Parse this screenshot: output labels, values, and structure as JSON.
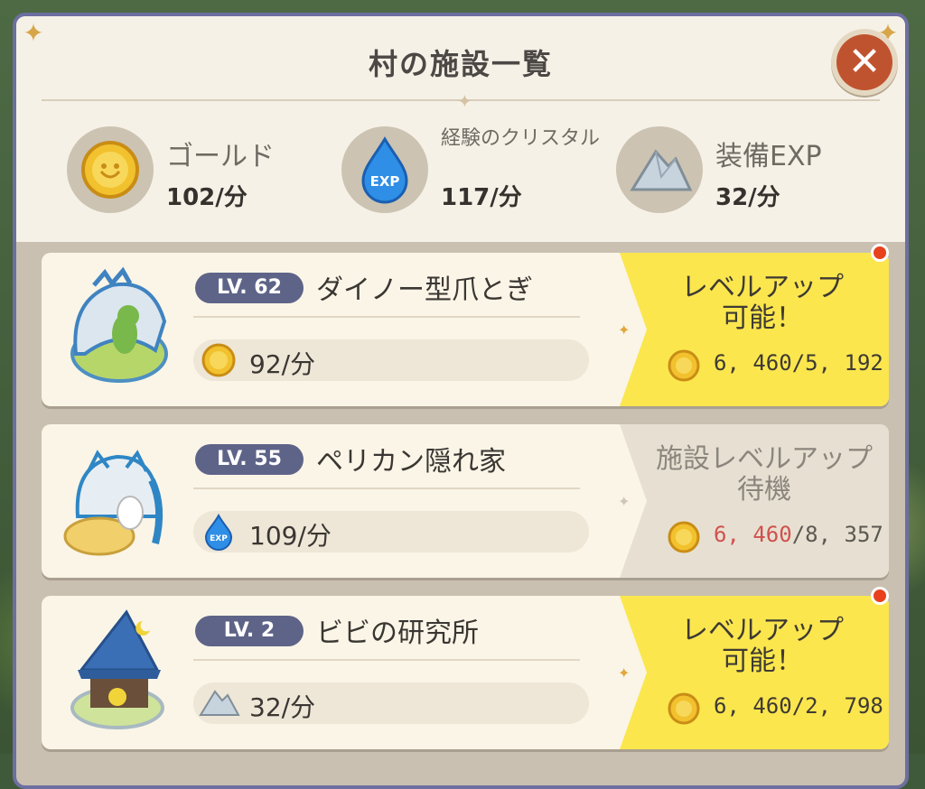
{
  "header": {
    "title": "村の施設一覧"
  },
  "resources": [
    {
      "name": "ゴールド",
      "rate": "102/分",
      "icon": "gold-coin-icon"
    },
    {
      "name": "経験のクリスタル",
      "rate": "117/分",
      "icon": "exp-crystal-icon"
    },
    {
      "name": "装備EXP",
      "rate": "32/分",
      "icon": "equipment-ore-icon"
    }
  ],
  "facilities": [
    {
      "level": "LV. 62",
      "name": "ダイノー型爪とぎ",
      "rate": "92/分",
      "rate_icon": "gold-coin-icon",
      "status": "レベルアップ\n可能！",
      "ready": true,
      "cost_have": "6, 460",
      "cost_sep": "/",
      "cost_need": "5, 192",
      "cost_have_short": false
    },
    {
      "level": "LV. 55",
      "name": "ペリカン隠れ家",
      "rate": "109/分",
      "rate_icon": "exp-crystal-icon",
      "status": "施設レベルアップ待機",
      "ready": false,
      "cost_have": "6, 460",
      "cost_sep": "/",
      "cost_need": "8, 357",
      "cost_have_short": true
    },
    {
      "level": "LV. 2",
      "name": "ビビの研究所",
      "rate": "32/分",
      "rate_icon": "equipment-ore-icon",
      "status": "レベルアップ\n可能！",
      "ready": true,
      "cost_have": "6, 460",
      "cost_sep": "/",
      "cost_need": "2, 798",
      "cost_have_short": false
    }
  ],
  "colors": {
    "ready": "#fbe64e",
    "waiting": "#e7e0d2",
    "short": "#d0514e",
    "close": "#c0532f",
    "level_badge": "#5e6488"
  },
  "close_label": "✕"
}
